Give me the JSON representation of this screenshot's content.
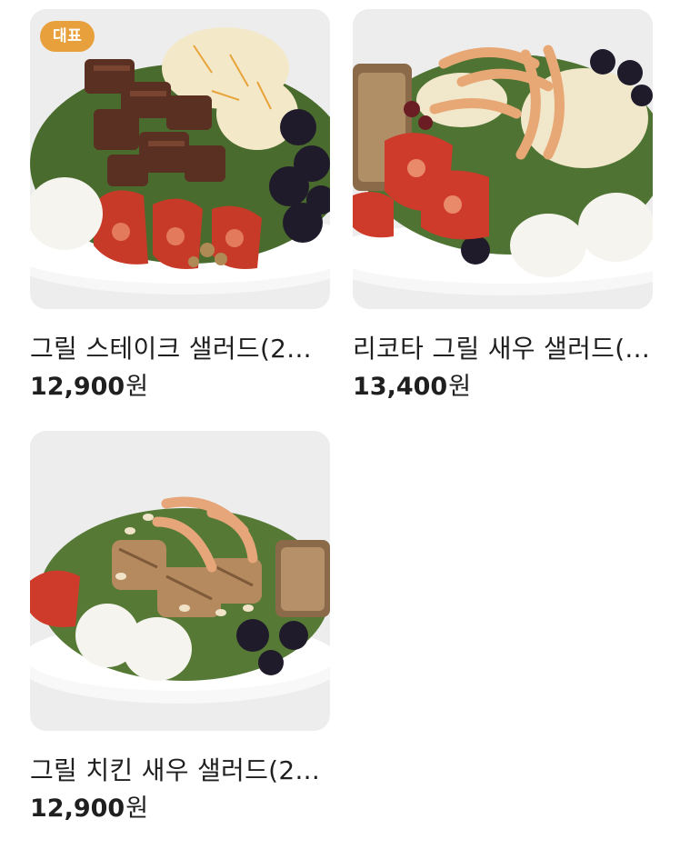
{
  "menu": {
    "items": [
      {
        "name": "그릴 스테이크 샐러드(2...",
        "price": "12,900",
        "currency": "원",
        "badge": "대표",
        "image_icon": "steak-salad-photo"
      },
      {
        "name": "리코타 그릴 새우 샐러드(...",
        "price": "13,400",
        "currency": "원",
        "badge": null,
        "image_icon": "shrimp-salad-photo"
      },
      {
        "name": "그릴 치킨 새우 샐러드(2...",
        "price": "12,900",
        "currency": "원",
        "badge": null,
        "image_icon": "chicken-shrimp-salad-photo"
      }
    ]
  },
  "colors": {
    "badge_bg": "#e8a03c",
    "text": "#1f1f1f",
    "background": "#ffffff"
  }
}
